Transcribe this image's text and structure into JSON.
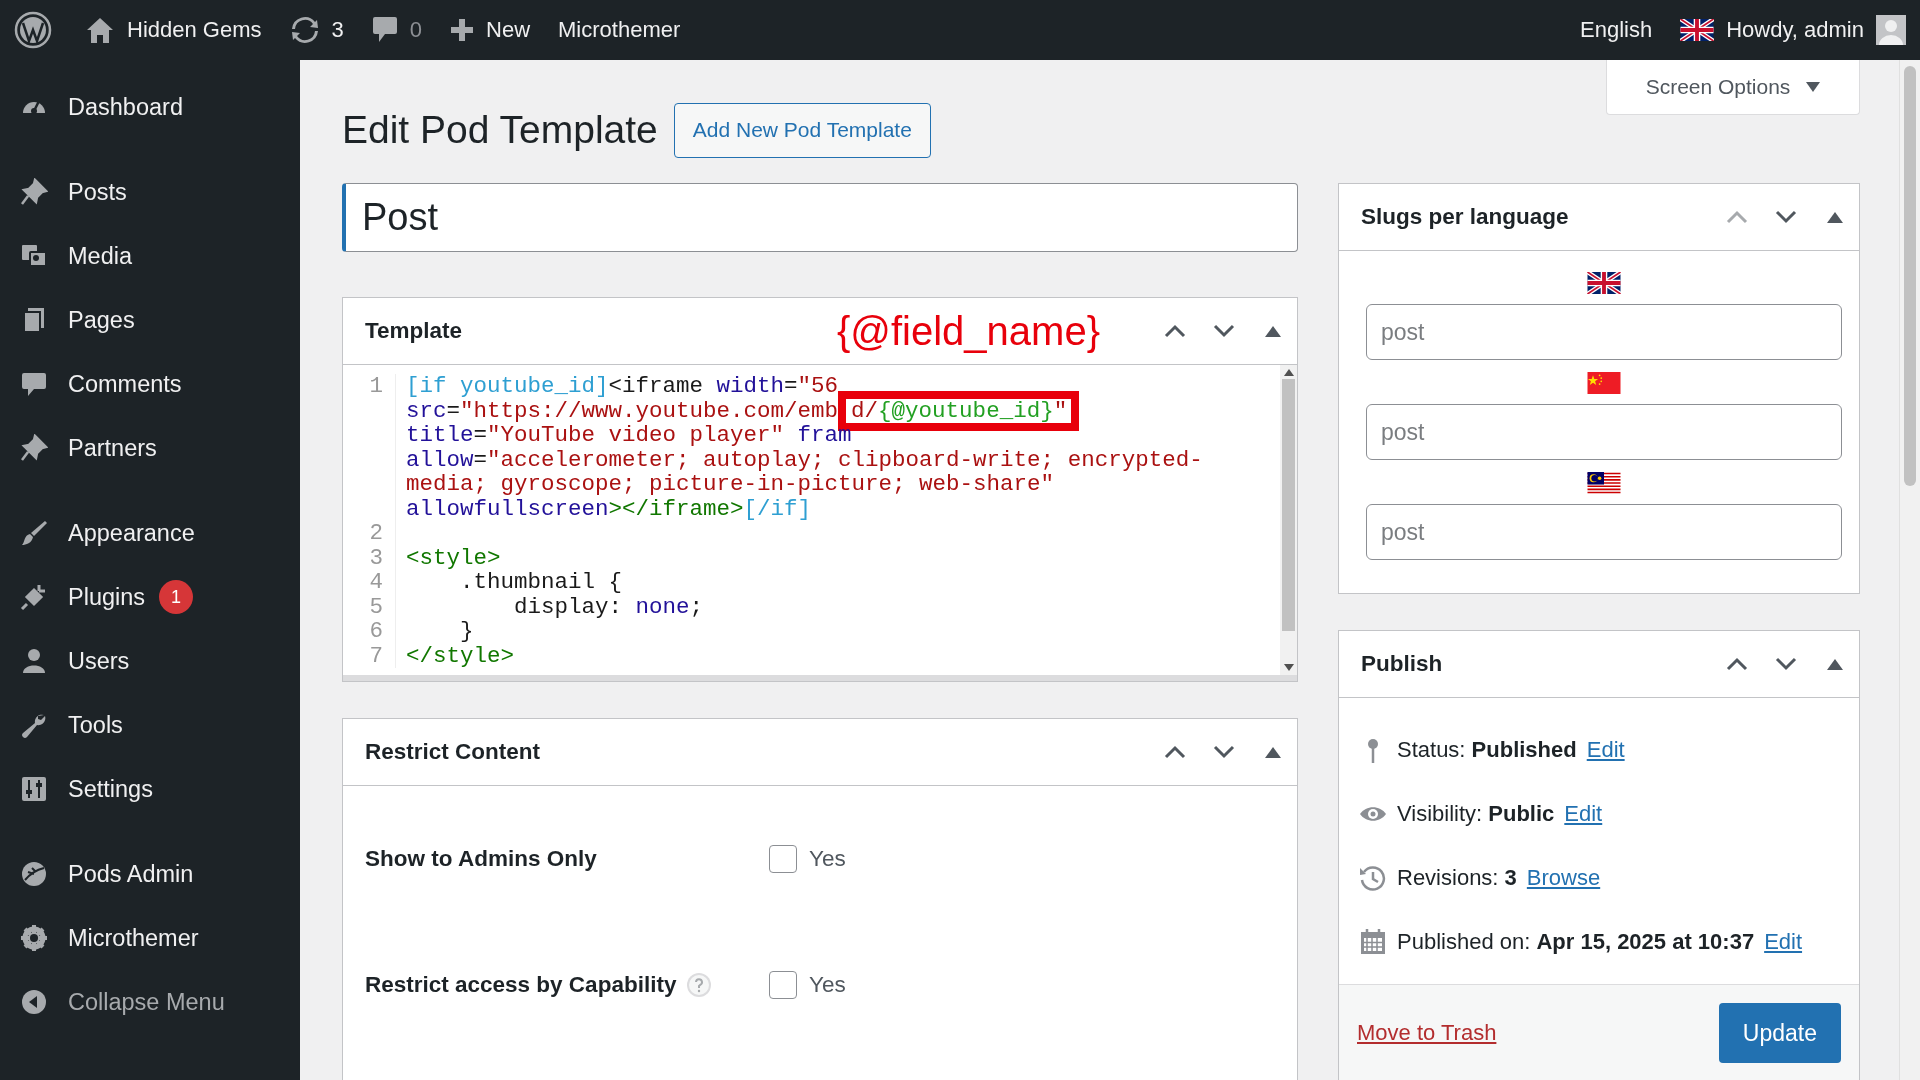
{
  "admin_bar": {
    "left": [
      {
        "kind": "logo"
      },
      {
        "kind": "site",
        "label": "Hidden Gems"
      },
      {
        "kind": "updates",
        "label": "3"
      },
      {
        "kind": "comments",
        "label": "0"
      },
      {
        "kind": "new",
        "label": "New"
      },
      {
        "kind": "text",
        "label": "Microthemer"
      }
    ],
    "right": [
      {
        "kind": "language",
        "label": "English"
      },
      {
        "kind": "account",
        "label": "Howdy, admin"
      }
    ]
  },
  "sidebar": {
    "groups": [
      [
        {
          "kind": "menu",
          "label": "Dashboard"
        }
      ],
      [
        {
          "kind": "menu",
          "label": "Posts"
        },
        {
          "kind": "menu",
          "label": "Media"
        },
        {
          "kind": "menu",
          "label": "Pages"
        },
        {
          "kind": "menu",
          "label": "Comments"
        },
        {
          "kind": "menu",
          "label": "Partners"
        }
      ],
      [
        {
          "kind": "menu",
          "label": "Appearance"
        },
        {
          "kind": "menu",
          "label": "Plugins",
          "badge": "1"
        },
        {
          "kind": "menu",
          "label": "Users"
        },
        {
          "kind": "menu",
          "label": "Tools"
        },
        {
          "kind": "menu",
          "label": "Settings"
        }
      ],
      [
        {
          "kind": "menu",
          "label": "Pods Admin"
        },
        {
          "kind": "menu",
          "label": "Microthemer"
        },
        {
          "kind": "collapse",
          "label": "Collapse Menu"
        }
      ]
    ]
  },
  "screen_options": {
    "label": "Screen Options"
  },
  "page": {
    "title": "Edit Pod Template",
    "add_button": "Add New Pod Template",
    "name_value": "Post"
  },
  "template_box": {
    "title": "Template",
    "annotation": "{@field_name}",
    "up_disabled": false,
    "rows": [
      {
        "number": "1",
        "segments": [
          {
            "kind": "shortcode",
            "text": "[if youtube_id]",
            "highlighted": false
          },
          {
            "kind": "plain",
            "text": "<iframe ",
            "highlighted": false
          },
          {
            "kind": "attr",
            "text": "width",
            "highlighted": false
          },
          {
            "kind": "plain",
            "text": "=",
            "highlighted": false
          },
          {
            "kind": "string",
            "text": "\"56",
            "highlighted": false
          }
        ]
      },
      {
        "segments": [
          {
            "kind": "attr",
            "text": "src",
            "highlighted": false
          },
          {
            "kind": "plain",
            "text": "=",
            "highlighted": false
          },
          {
            "kind": "string",
            "text": "\"https://www.youtube.com/emb",
            "highlighted": false
          },
          {
            "kind": "string",
            "text": "d/",
            "highlighted": true
          },
          {
            "kind": "field",
            "text": "{@youtube_id}",
            "highlighted": true
          },
          {
            "kind": "string",
            "text": "\"",
            "highlighted": true
          }
        ]
      },
      {
        "segments": [
          {
            "kind": "attr",
            "text": "title",
            "highlighted": false
          },
          {
            "kind": "plain",
            "text": "=",
            "highlighted": false
          },
          {
            "kind": "string",
            "text": "\"YouTube video player\" ",
            "highlighted": false
          },
          {
            "kind": "attr",
            "text": "fram",
            "highlighted": false
          }
        ]
      },
      {
        "segments": [
          {
            "kind": "attr",
            "text": "allow",
            "highlighted": false
          },
          {
            "kind": "plain",
            "text": "=",
            "highlighted": false
          },
          {
            "kind": "string",
            "text": "\"accelerometer; autoplay; clipboard-write; encrypted-",
            "highlighted": false
          }
        ]
      },
      {
        "segments": [
          {
            "kind": "string",
            "text": "media; gyroscope; picture-in-picture; web-share\"",
            "highlighted": false
          }
        ]
      },
      {
        "segments": [
          {
            "kind": "attr",
            "text": "allowfullscreen",
            "highlighted": false
          },
          {
            "kind": "tag",
            "text": "></iframe>",
            "highlighted": false
          },
          {
            "kind": "shortcode",
            "text": "[/if]",
            "highlighted": false
          }
        ]
      },
      {
        "number": "2",
        "segments": []
      },
      {
        "number": "3",
        "segments": [
          {
            "kind": "tag",
            "text": "<style>",
            "highlighted": false
          }
        ]
      },
      {
        "number": "4",
        "segments": [
          {
            "kind": "plain",
            "text": "    .thumbnail {",
            "highlighted": false
          }
        ]
      },
      {
        "number": "5",
        "segments": [
          {
            "kind": "plain",
            "text": "        display: ",
            "highlighted": false
          },
          {
            "kind": "attr",
            "text": "none",
            "highlighted": false
          },
          {
            "kind": "plain",
            "text": ";",
            "highlighted": false
          }
        ]
      },
      {
        "number": "6",
        "segments": [
          {
            "kind": "plain",
            "text": "    }",
            "highlighted": false
          }
        ]
      },
      {
        "number": "7",
        "segments": [
          {
            "kind": "tag",
            "text": "</style>",
            "highlighted": false
          }
        ]
      }
    ]
  },
  "restrict_box": {
    "title": "Restrict Content",
    "up_disabled": false,
    "fields": [
      {
        "label": "Show to Admins Only",
        "help": false,
        "option": "Yes",
        "checked": false
      },
      {
        "label": "Restrict access by Capability",
        "help": true,
        "option": "Yes",
        "checked": false
      }
    ]
  },
  "slugs_box": {
    "title": "Slugs per language",
    "up_disabled": true,
    "slugs": [
      {
        "kind": "gb",
        "placeholder": "post"
      },
      {
        "kind": "cn",
        "placeholder": "post"
      },
      {
        "kind": "my",
        "placeholder": "post"
      }
    ]
  },
  "publish_box": {
    "title": "Publish",
    "up_disabled": false,
    "rows": [
      {
        "kind": "status",
        "text": "Status: **Published**",
        "link": "Edit"
      },
      {
        "kind": "visibility",
        "text": "Visibility: **Public**",
        "link": "Edit"
      },
      {
        "kind": "revisions",
        "text": "Revisions: **3**",
        "link": "Browse"
      },
      {
        "kind": "date",
        "text": "Published on: **Apr 15, 2025 at 10:37**",
        "link": "Edit"
      }
    ],
    "trash_link": "Move to Trash",
    "update_button": "Update"
  }
}
